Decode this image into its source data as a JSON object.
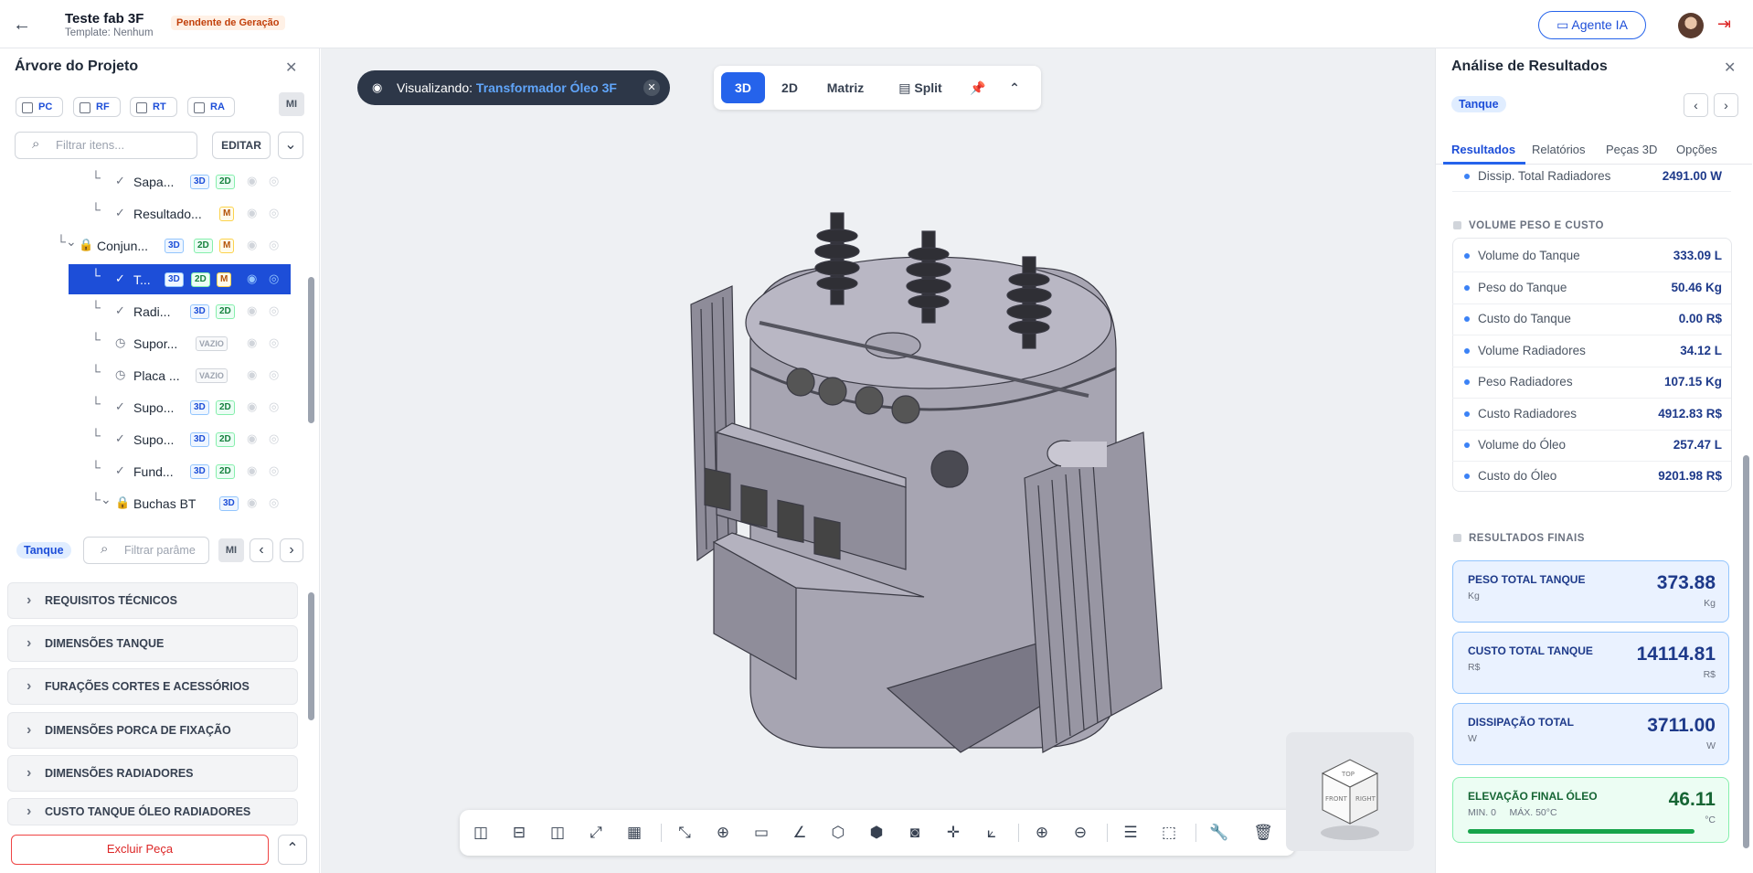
{
  "header": {
    "title": "Teste fab 3F",
    "template": "Template: Nenhum",
    "status_badge": "Pendente de Geração",
    "agent_button": "Agente IA"
  },
  "left_panel": {
    "title": "Árvore do Projeto",
    "checkboxes": [
      "PC",
      "RF",
      "RT",
      "RA"
    ],
    "mi_label": "MI",
    "filter_placeholder": "Filtrar itens...",
    "edit_button": "EDITAR",
    "tree": [
      {
        "label": "Sapa...",
        "tags": [
          "3D",
          "2D"
        ],
        "status": "check"
      },
      {
        "label": "Resultado...",
        "tags": [
          "M"
        ],
        "status": "check"
      },
      {
        "label": "Conjun...",
        "tags": [
          "3D",
          "2D",
          "M"
        ],
        "status": "lock"
      },
      {
        "label": "T...",
        "tags": [
          "3D",
          "2D",
          "M"
        ],
        "status": "check",
        "selected": true
      },
      {
        "label": "Radi...",
        "tags": [
          "3D",
          "2D"
        ],
        "status": "check"
      },
      {
        "label": "Supor...",
        "tags": [
          "VAZIO"
        ],
        "status": "clock"
      },
      {
        "label": "Placa ...",
        "tags": [
          "VAZIO"
        ],
        "status": "clock"
      },
      {
        "label": "Supo...",
        "tags": [
          "3D",
          "2D"
        ],
        "status": "check"
      },
      {
        "label": "Supo...",
        "tags": [
          "3D",
          "2D"
        ],
        "status": "check"
      },
      {
        "label": "Fund...",
        "tags": [
          "3D",
          "2D"
        ],
        "status": "check"
      },
      {
        "label": "Buchas BT",
        "tags": [
          "3D"
        ],
        "status": "lock"
      }
    ],
    "param_pill": "Tanque",
    "param_placeholder": "Filtrar parâme",
    "param_mi": "MI",
    "sections": [
      "REQUISITOS TÉCNICOS",
      "DIMENSÕES TANQUE",
      "FURAÇÕES CORTES E ACESSÓRIOS",
      "DIMENSÕES PORCA DE FIXAÇÃO",
      "DIMENSÕES RADIADORES",
      "CUSTO TANQUE ÓLEO RADIADORES"
    ],
    "delete_button": "Excluir Peça"
  },
  "viewport": {
    "viewing_label": "Visualizando:",
    "viewing_value": "Transformador Óleo 3F",
    "modes": [
      "3D",
      "2D",
      "Matriz",
      "Split"
    ],
    "active_mode": "3D",
    "cube_faces": [
      "TOP",
      "FRONT",
      "RIGHT"
    ]
  },
  "right_panel": {
    "title": "Análise de Resultados",
    "pill": "Tanque",
    "tabs": [
      "Resultados",
      "Relatórios",
      "Peças 3D",
      "Opções"
    ],
    "active_tab": "Resultados",
    "top_row": {
      "label": "Dissip. Total Radiadores",
      "value": "2491.00 W"
    },
    "section1": "VOLUME PESO E CUSTO",
    "rows": [
      {
        "label": "Volume do Tanque",
        "value": "333.09 L"
      },
      {
        "label": "Peso do Tanque",
        "value": "50.46 Kg"
      },
      {
        "label": "Custo do Tanque",
        "value": "0.00 R$"
      },
      {
        "label": "Volume Radiadores",
        "value": "34.12 L"
      },
      {
        "label": "Peso Radiadores",
        "value": "107.15 Kg"
      },
      {
        "label": "Custo Radiadores",
        "value": "4912.83 R$"
      },
      {
        "label": "Volume do Óleo",
        "value": "257.47 L"
      },
      {
        "label": "Custo do Óleo",
        "value": "9201.98 R$"
      }
    ],
    "section2": "RESULTADOS FINAIS",
    "cards": [
      {
        "label": "PESO TOTAL TANQUE",
        "unit": "Kg",
        "value": "373.88",
        "unit2": "Kg"
      },
      {
        "label": "CUSTO TOTAL TANQUE",
        "unit": "R$",
        "value": "14114.81",
        "unit2": "R$"
      },
      {
        "label": "DISSIPAÇÃO TOTAL",
        "unit": "W",
        "value": "3711.00",
        "unit2": "W"
      },
      {
        "label": "ELEVAÇÃO FINAL ÓLEO",
        "unit": "MIN. 0     MÁX. 50°C",
        "value": "46.11",
        "unit2": "°C",
        "level": 0.92
      }
    ]
  },
  "colors": {
    "accent": "#2563eb",
    "danger": "#dc2626",
    "success": "#16a34a"
  }
}
